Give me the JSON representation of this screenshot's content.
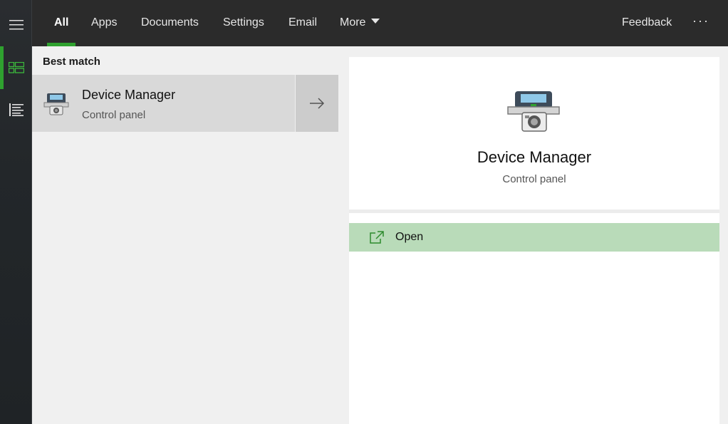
{
  "tabs": [
    {
      "label": "All",
      "active": true
    },
    {
      "label": "Apps"
    },
    {
      "label": "Documents"
    },
    {
      "label": "Settings"
    },
    {
      "label": "Email"
    },
    {
      "label": "More"
    }
  ],
  "header": {
    "feedback": "Feedback",
    "more_options": "···"
  },
  "rail": {
    "icons": [
      "hamburger-icon",
      "all-results-icon",
      "list-icon"
    ],
    "accent": "#2fa12f"
  },
  "results": {
    "section_label": "Best match",
    "best_match": {
      "title": "Device Manager",
      "subtitle": "Control panel",
      "icon": "device-manager-icon"
    }
  },
  "preview": {
    "title": "Device Manager",
    "subtitle": "Control panel",
    "actions": [
      {
        "label": "Open",
        "icon": "open-external-icon"
      }
    ]
  },
  "colors": {
    "accent": "#2fa12f",
    "action_highlight": "#b9dbb9",
    "topbar": "#2b2b2b"
  }
}
